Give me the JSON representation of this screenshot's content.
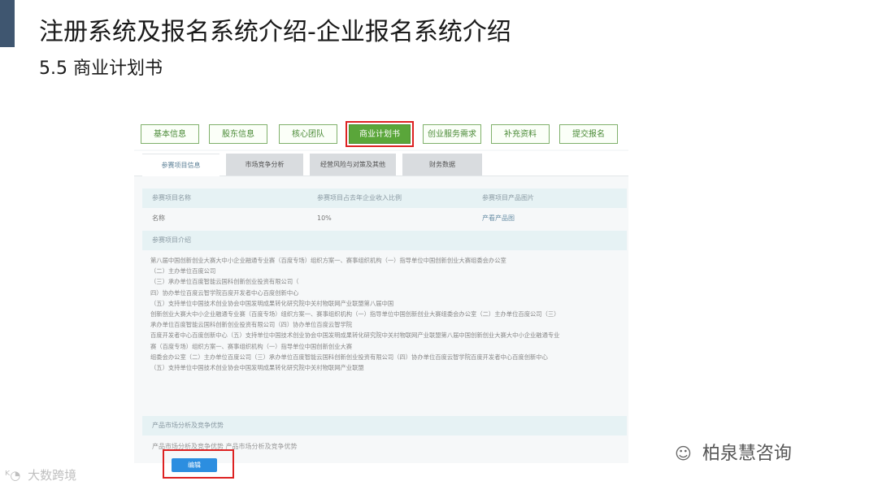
{
  "slide": {
    "title": "注册系统及报名系统介绍-企业报名系统介绍",
    "subtitle": "5.5 商业计划书"
  },
  "steps": [
    {
      "label": "基本信息",
      "active": false
    },
    {
      "label": "股东信息",
      "active": false
    },
    {
      "label": "核心团队",
      "active": false
    },
    {
      "label": "商业计划书",
      "active": true
    },
    {
      "label": "创业服务需求",
      "active": false
    },
    {
      "label": "补充资料",
      "active": false
    },
    {
      "label": "提交报名",
      "active": false
    }
  ],
  "subtabs": [
    {
      "label": "参赛项目信息",
      "active": true
    },
    {
      "label": "市场竞争分析",
      "active": false
    },
    {
      "label": "经营风险与对策及其他",
      "active": false
    },
    {
      "label": "财务数据",
      "active": false
    }
  ],
  "project_table": {
    "headers": [
      "参赛项目名称",
      "参赛项目占去年企业收入比例",
      "参赛项目产品图片"
    ],
    "values": [
      "名称",
      "10%",
      "产看产品图"
    ]
  },
  "intro": {
    "heading": "参赛项目介绍",
    "lines": [
      "第八届中国创新创业大赛大中小企业融通专业赛（百度专场）组织方案一、赛事组织机构（一）指导单位中国创新创业大赛组委会办公室",
      "（二）主办单位百度公司",
      "（三）承办单位百度智能云国科创新创业投资有限公司（",
      "四）协办单位百度云智学院百度开发者中心百度创新中心",
      "（五）支持单位中国技术创业协会中国发明成果转化研究院中关村物联网产业联盟第八届中国",
      "创新创业大赛大中小企业融通专业赛（百度专场）组织方案一、赛事组织机构（一）指导单位中国创新创业大赛组委会办公室（二）主办单位百度公司（三）",
      "承办单位百度智能云国科创新创业投资有限公司（四）协办单位百度云智学院",
      "百度开发者中心百度创新中心（五）支持单位中国技术创业协会中国发明成果转化研究院中关村物联网产业联盟第八届中国创新创业大赛大中小企业融通专业",
      "赛（百度专场）组织方案一、赛事组织机构（一）指导单位中国创新创业大赛",
      "组委会办公室（二）主办单位百度公司（三）承办单位百度智能云国科创新创业投资有限公司（四）协办单位百度云智学院百度开发者中心百度创新中心",
      "（五）支持单位中国技术创业协会中国发明成果转化研究院中关村物联网产业联盟"
    ]
  },
  "market": {
    "heading": "产品市场分析及竞争优势",
    "text": "产品市场分析及竞争优势 产品市场分析及竞争优势"
  },
  "edit_button": {
    "label": "编辑"
  },
  "watermarks": {
    "left": "大数跨境",
    "right": "柏泉慧咨询"
  },
  "colors": {
    "accent_bar": "#3f5670",
    "step_active": "#5aa63a",
    "highlight_box": "#dd2222",
    "edit_button": "#2c8ee0"
  }
}
